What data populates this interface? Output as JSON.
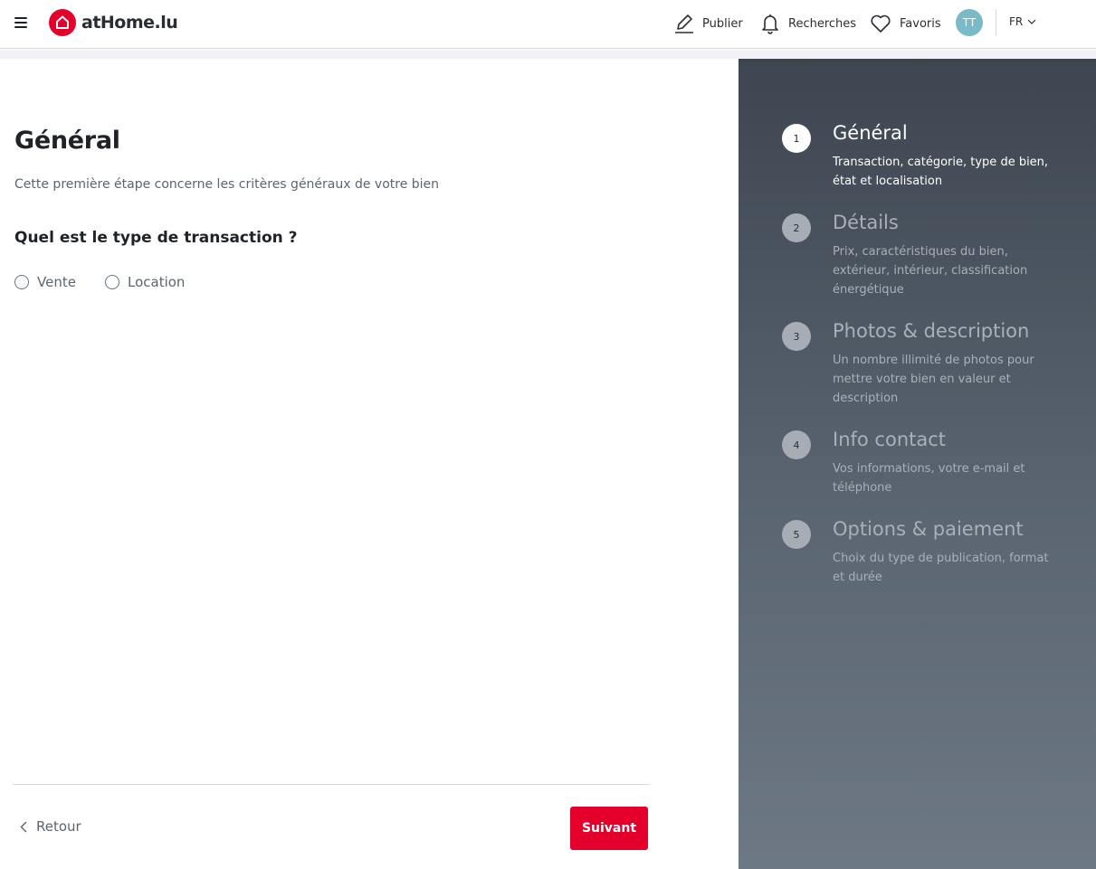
{
  "header": {
    "logo_text": "atHome.lu",
    "nav": {
      "publier": "Publier",
      "recherches": "Recherches",
      "favoris": "Favoris"
    },
    "avatar_initials": "TT",
    "language": "FR"
  },
  "main": {
    "title": "Général",
    "subtitle": "Cette première étape concerne les critères généraux de votre bien",
    "question": "Quel est le type de transaction ?",
    "options": [
      "Vente",
      "Location"
    ],
    "back_label": "Retour",
    "next_label": "Suivant"
  },
  "steps": [
    {
      "number": "1",
      "title": "Général",
      "description": "Transaction, catégorie, type de bien, état et localisation",
      "active": true
    },
    {
      "number": "2",
      "title": "Détails",
      "description": "Prix, caractéristiques du bien, extérieur, intérieur, classification énergétique",
      "active": false
    },
    {
      "number": "3",
      "title": "Photos & description",
      "description": "Un nombre illimité de photos pour mettre votre bien en valeur et description",
      "active": false
    },
    {
      "number": "4",
      "title": "Info contact",
      "description": "Vos informations, votre e-mail et téléphone",
      "active": false
    },
    {
      "number": "5",
      "title": "Options & paiement",
      "description": "Choix du type de publication, format et durée",
      "active": false
    }
  ],
  "icons": {
    "menu": "hamburger-icon",
    "logo": "house-icon",
    "publier": "pencil-icon",
    "recherches": "bell-icon",
    "favoris": "heart-icon",
    "language": "chevron-down-icon",
    "back": "chevron-left-icon"
  },
  "colors": {
    "brand": "#e4002b",
    "avatar": "#7ab9c6",
    "sidebar_top": "#3d4550",
    "sidebar_bottom": "#6d7884"
  }
}
